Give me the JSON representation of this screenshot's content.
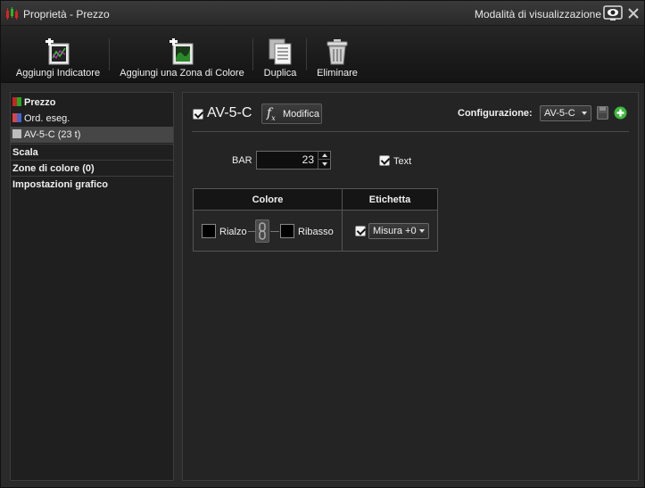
{
  "window": {
    "title": "Proprietà - Prezzo",
    "view_mode_label": "Modalità di visualizzazione"
  },
  "toolbar": {
    "add_indicator": "Aggiungi Indicatore",
    "add_color_zone": "Aggiungi una Zona di Colore",
    "duplicate": "Duplica",
    "delete": "Eliminare"
  },
  "sidebar": {
    "items": [
      {
        "label": "Prezzo",
        "icon": "candlestick-swatch"
      },
      {
        "label": "Ord. eseg.",
        "icon": "order-swatch"
      },
      {
        "label": "AV-5-C (23 t)",
        "icon": "gray-swatch"
      }
    ],
    "sections": [
      "Scala",
      "Zone di colore (0)",
      "Impostazioni grafico"
    ]
  },
  "panel": {
    "indicator_name": "AV-5-C",
    "edit_button": "Modifica",
    "config_label": "Configurazione:",
    "config_value": "AV-5-C",
    "bar_label": "BAR",
    "bar_value": "23",
    "text_label": "Text",
    "table": {
      "col_color": "Colore",
      "col_label": "Etichetta",
      "up_label": "Rialzo",
      "down_label": "Ribasso",
      "label_select": "Misura +0"
    }
  },
  "colors": {
    "add_green": "#3db83d",
    "up_red": "#cc2222",
    "down_green": "#22aa22"
  }
}
